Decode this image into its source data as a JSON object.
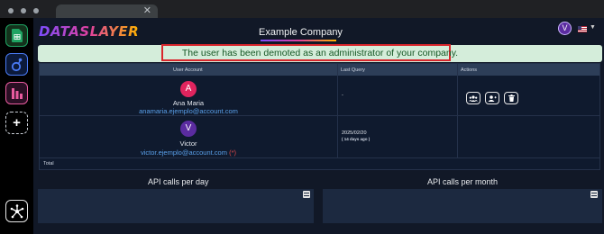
{
  "browser": {
    "tab_close": "✕"
  },
  "rail": {
    "items": [
      "google-sheets",
      "looker-studio",
      "power-bi"
    ],
    "add_label": "+"
  },
  "header": {
    "logo_text": "DATASLAYER",
    "company_name": "Example Company",
    "user_initial": "V",
    "language_flag": "us-flag"
  },
  "alert": {
    "message": "The user has been demoted as an administrator of your company."
  },
  "table": {
    "columns": [
      "User Account",
      "Last Query",
      "Actions"
    ],
    "rows": [
      {
        "initial": "A",
        "name": "Ana Maria",
        "email": "anamaria.ejemplo@account.com",
        "last_query": "-",
        "avatar_color": "#e0245e"
      },
      {
        "initial": "V",
        "name": "Victor",
        "email": "victor.ejemplo@account.com",
        "email_marker": "(*)",
        "last_query_date": "2025/02/20",
        "last_query_ago": "( 14 days ago )",
        "avatar_color": "#5b2ca0"
      }
    ],
    "total_label": "Total"
  },
  "charts": [
    {
      "title": "API calls per day"
    },
    {
      "title": "API calls per month"
    }
  ],
  "colors": {
    "alert_bg": "#d4edda",
    "alert_text": "#155724",
    "highlight": "#d9262c",
    "link": "#5aa0ea"
  }
}
